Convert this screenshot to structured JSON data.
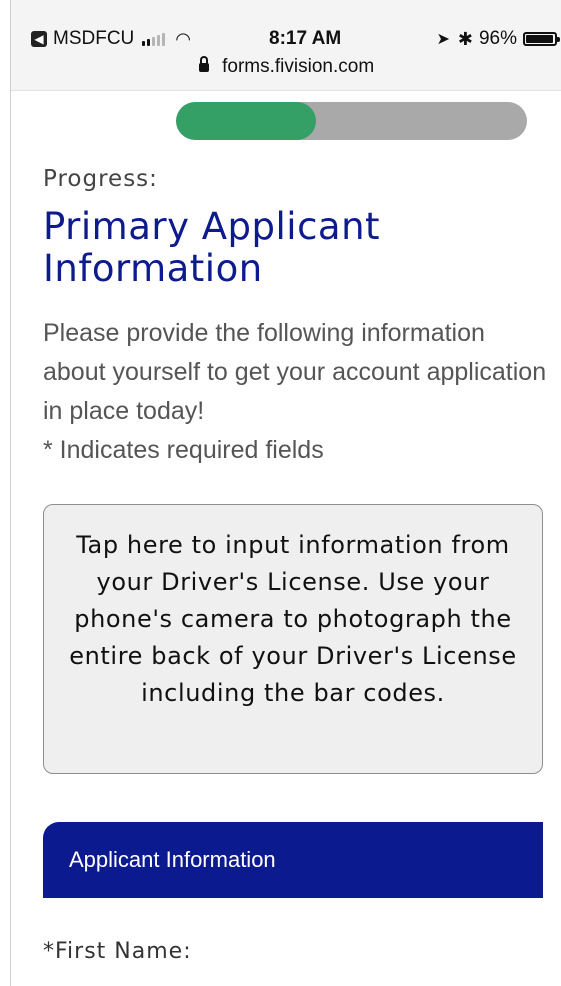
{
  "status_bar": {
    "carrier": "MSDFCU",
    "back_app_icon_glyph": "◀",
    "time": "8:17 AM",
    "battery": "96%",
    "battery_level": 0.96,
    "signal_bars_filled": 2,
    "signal_bars_total": 5,
    "icons": [
      "back-app-icon",
      "signal-icon",
      "wifi-icon",
      "location-icon",
      "bluetooth-icon",
      "battery-icon"
    ]
  },
  "address_bar": {
    "url": "forms.fivision.com",
    "icon": "lock-icon"
  },
  "progress": {
    "value": 0.4,
    "label": "Progress:",
    "fill_color": "#34a066",
    "track_color": "#a9a9a9"
  },
  "page": {
    "title": "Primary Applicant Information",
    "title_color": "#0d1b8c",
    "intro": "Please provide the following information about yourself to get your account application in place today!",
    "required_note": "* Indicates required fields"
  },
  "license_scan_button": {
    "label": "Tap here to input information from your Driver's License. Use your phone's camera to photograph the entire back of your Driver's License including the bar codes."
  },
  "section": {
    "header": "Applicant Information",
    "header_color": "#0c1a8f"
  },
  "fields": {
    "first_name_label": "*First Name:"
  }
}
